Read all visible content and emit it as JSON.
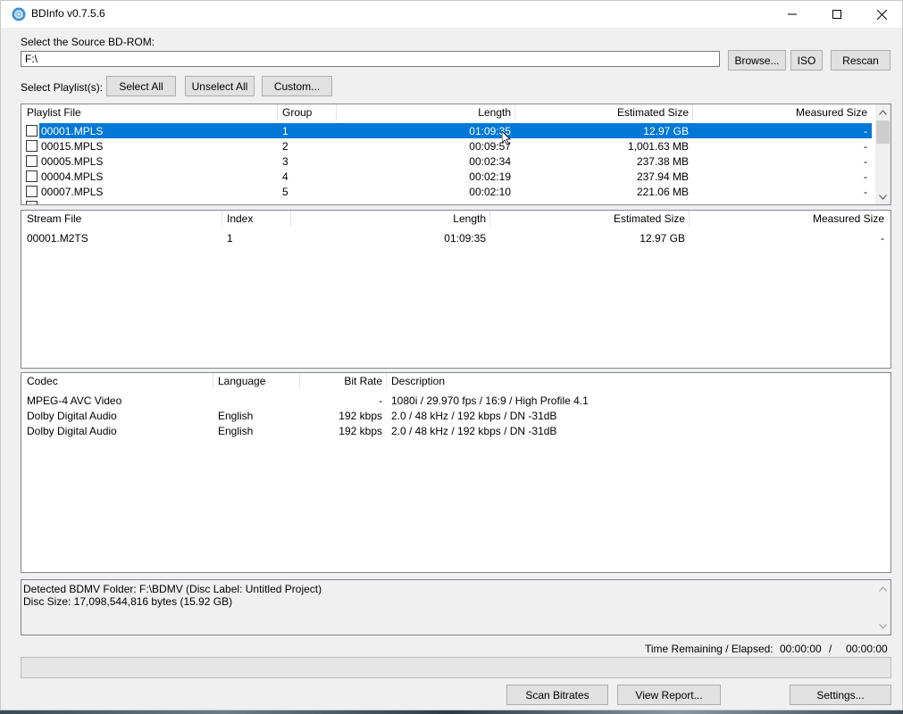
{
  "window": {
    "title": "BDInfo v0.7.5.6"
  },
  "source": {
    "label": "Select the Source BD-ROM:",
    "path": "F:\\",
    "browse_label": "Browse...",
    "iso_label": "ISO",
    "rescan_label": "Rescan"
  },
  "playlist_select": {
    "label": "Select Playlist(s):",
    "select_all_label": "Select All",
    "unselect_all_label": "Unselect All",
    "custom_label": "Custom..."
  },
  "playlists": {
    "headers": [
      "Playlist File",
      "Group",
      "Length",
      "Estimated Size",
      "Measured Size"
    ],
    "rows": [
      {
        "file": "00001.MPLS",
        "group": "1",
        "length": "01:09:35",
        "est": "12.97 GB",
        "meas": "-"
      },
      {
        "file": "00015.MPLS",
        "group": "2",
        "length": "00:09:57",
        "est": "1,001.63 MB",
        "meas": "-"
      },
      {
        "file": "00005.MPLS",
        "group": "3",
        "length": "00:02:34",
        "est": "237.38 MB",
        "meas": "-"
      },
      {
        "file": "00004.MPLS",
        "group": "4",
        "length": "00:02:19",
        "est": "237.94 MB",
        "meas": "-"
      },
      {
        "file": "00007.MPLS",
        "group": "5",
        "length": "00:02:10",
        "est": "221.06 MB",
        "meas": "-"
      }
    ]
  },
  "streams": {
    "headers": [
      "Stream File",
      "Index",
      "Length",
      "Estimated Size",
      "Measured Size"
    ],
    "rows": [
      {
        "file": "00001.M2TS",
        "index": "1",
        "length": "01:09:35",
        "est": "12.97 GB",
        "meas": "-"
      }
    ]
  },
  "codecs": {
    "headers": [
      "Codec",
      "Language",
      "Bit Rate",
      "Description"
    ],
    "rows": [
      {
        "codec": "MPEG-4 AVC Video",
        "lang": "",
        "rate": "-",
        "desc": "1080i / 29.970 fps / 16:9 / High Profile 4.1"
      },
      {
        "codec": "Dolby Digital Audio",
        "lang": "English",
        "rate": "192 kbps",
        "desc": "2.0 / 48 kHz /  192 kbps / DN -31dB"
      },
      {
        "codec": "Dolby Digital Audio",
        "lang": "English",
        "rate": "192 kbps",
        "desc": "2.0 / 48 kHz /  192 kbps / DN -31dB"
      }
    ]
  },
  "status": {
    "line1": "Detected BDMV Folder: F:\\BDMV (Disc Label: Untitled Project)",
    "line2": "Disc Size: 17,098,544,816 bytes (15.92 GB)"
  },
  "time": {
    "label": "Time Remaining / Elapsed:",
    "remaining": "00:00:00",
    "separator": "/",
    "elapsed": "00:00:00"
  },
  "progress": {
    "value": 0
  },
  "footer": {
    "scan_label": "Scan Bitrates",
    "report_label": "View Report...",
    "settings_label": "Settings..."
  }
}
